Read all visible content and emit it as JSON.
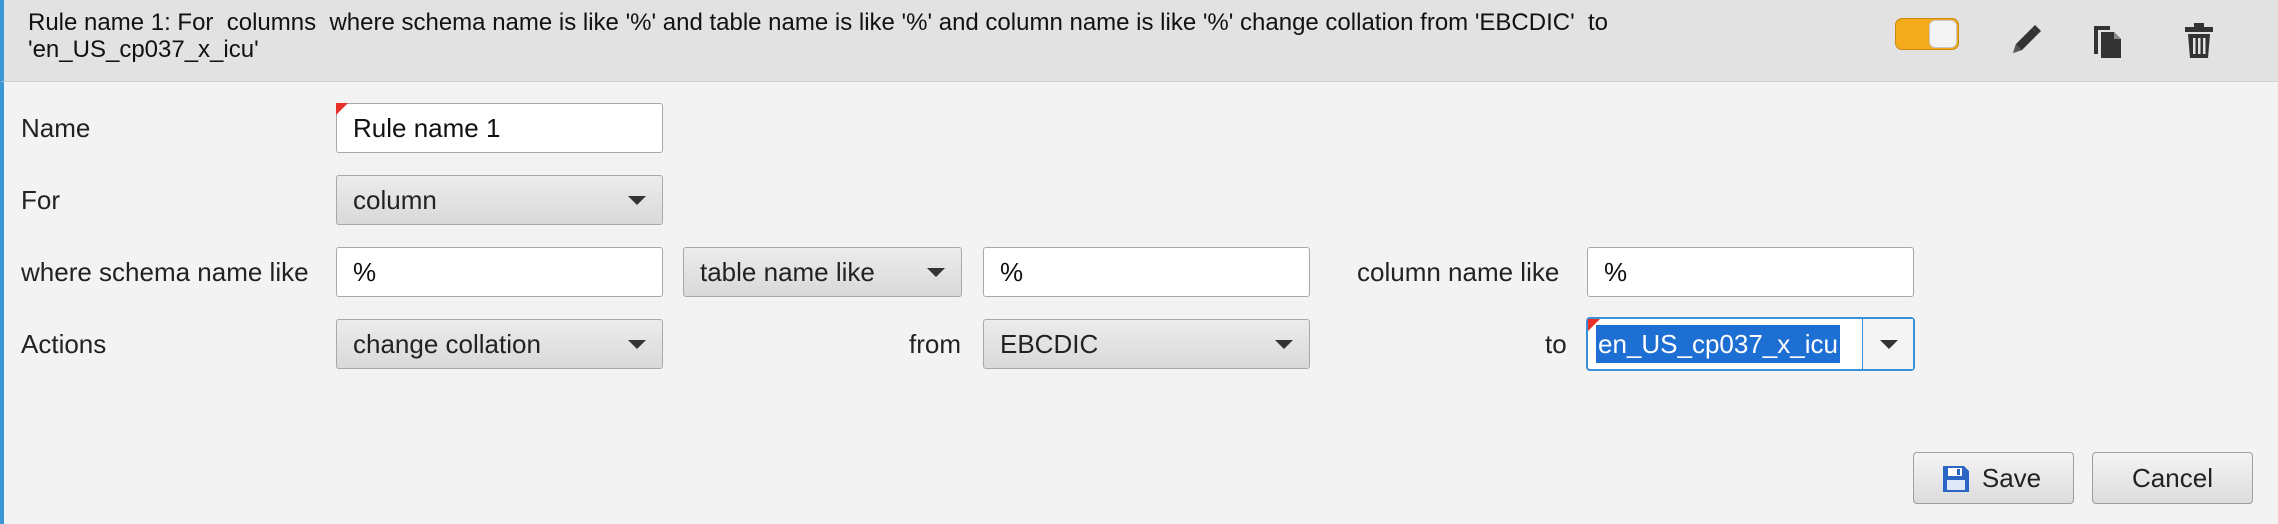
{
  "header": {
    "title": "Rule name 1: For  columns  where schema name is like '%' and table name is like '%' and column name is like '%' change collation from 'EBCDIC'  to 'en_US_cp037_x_icu'",
    "toggle_state": "on",
    "icons": [
      "edit-icon",
      "copy-icon",
      "trash-icon"
    ],
    "accent_color": "#f3ab1b"
  },
  "form": {
    "name_label": "Name",
    "name_value": "Rule name 1",
    "for_label": "For",
    "for_value": "column",
    "where_label": "where schema name like",
    "schema_value": "%",
    "table_selector": "table name like",
    "table_value": "%",
    "column_label": "column name like",
    "column_value": "%",
    "actions_label": "Actions",
    "action_value": "change collation",
    "from_label": "from",
    "from_value": "EBCDIC",
    "to_label": "to",
    "to_value": "en_US_cp037_x_icu"
  },
  "footer": {
    "save_label": "Save",
    "cancel_label": "Cancel"
  },
  "colors": {
    "left_border": "#3a97d4",
    "selection": "#1d6fd4",
    "flag": "#e8302a"
  }
}
